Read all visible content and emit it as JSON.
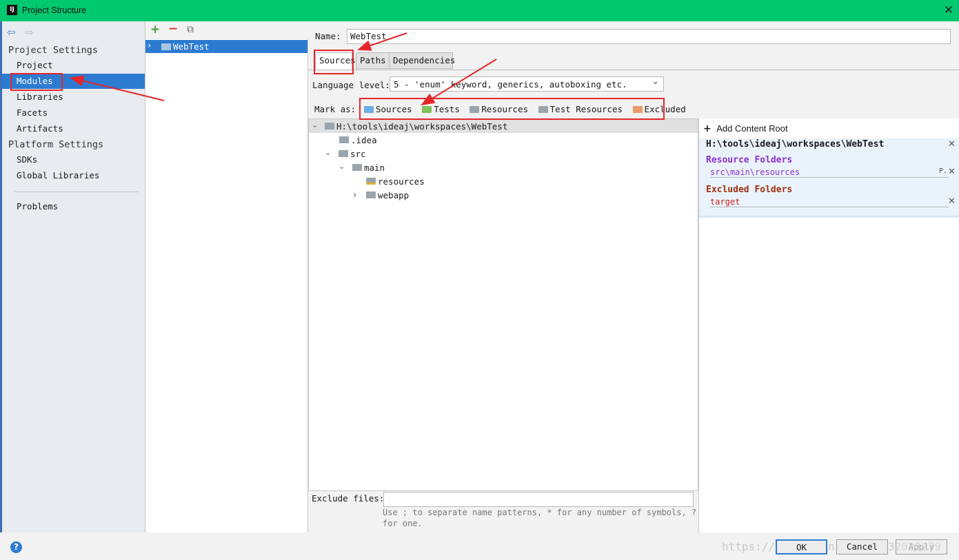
{
  "window": {
    "title": "Project Structure",
    "close_glyph": "✕",
    "logo_text": "IJ"
  },
  "nav": {
    "back_glyph": "⇦",
    "forward_glyph": "⇨",
    "project_settings_header": "Project Settings",
    "project_items": [
      "Project",
      "Modules",
      "Libraries",
      "Facets",
      "Artifacts"
    ],
    "platform_settings_header": "Platform Settings",
    "platform_items": [
      "SDKs",
      "Global Libraries"
    ],
    "problems": "Problems"
  },
  "modules": {
    "add_glyph": "+",
    "remove_glyph": "−",
    "copy_glyph": "⧉",
    "expand_glyph": "›",
    "selected_module": "WebTest"
  },
  "module_settings": {
    "name_label": "Name:",
    "name_value": "WebTest",
    "tabs": [
      "Sources",
      "Paths",
      "Dependencies"
    ],
    "language_level_label": "Language level:",
    "language_level_value": "5 - 'enum' keyword, generics, autoboxing etc.",
    "dropdown_glyph": "⌄",
    "mark_as_label": "Mark as:",
    "mark_as": [
      {
        "label": "Sources",
        "color": "#6aaee8"
      },
      {
        "label": "Tests",
        "color": "#7fc35a"
      },
      {
        "label": "Resources",
        "color": "#9aa4ad"
      },
      {
        "label": "Test Resources",
        "color": "#9aa4ad"
      },
      {
        "label": "Excluded",
        "color": "#ee9a6a"
      }
    ]
  },
  "tree": {
    "root": "H:\\tools\\ideaj\\workspaces\\WebTest",
    "idea": ".idea",
    "src": "src",
    "main": "main",
    "resources": "resources",
    "webapp": "webapp",
    "collapse_glyph": "⌄",
    "expand_glyph": "›"
  },
  "content_roots": {
    "add_glyph": "+",
    "add_label": "Add Content Root",
    "root_path": "H:\\tools\\ideaj\\workspaces\\WebTest",
    "close_glyph": "✕",
    "resource_folders_header": "Resource Folders",
    "resource_folder": "src\\main\\resources",
    "resource_props_glyph": "P.",
    "excluded_folders_header": "Excluded Folders",
    "excluded_folder": "target",
    "colors": {
      "resource": "#8b2fd0",
      "excluded": "#a03010",
      "resource_path": "#8b2fd0",
      "excluded_path": "#cc2020"
    }
  },
  "exclude": {
    "label": "Exclude files:",
    "hint_line1": "Use ; to separate name patterns, * for any number of symbols, ?",
    "hint_line2": "for one."
  },
  "footer": {
    "help_glyph": "?",
    "ok": "OK",
    "cancel": "Cancel",
    "apply": "Apply",
    "watermark": "https://blog.csdn.net/qq_32023279"
  }
}
